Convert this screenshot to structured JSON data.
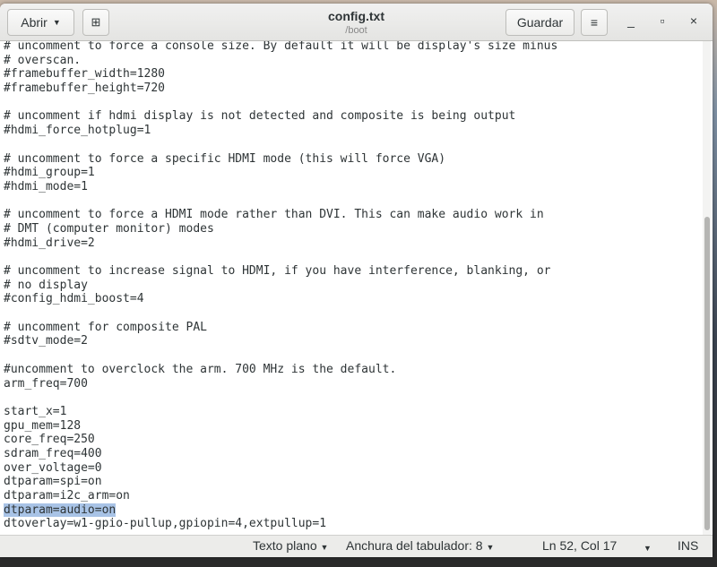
{
  "header": {
    "open_label": "Abrir",
    "title": "config.txt",
    "subtitle": "/boot",
    "save_label": "Guardar"
  },
  "editor": {
    "lines": [
      "# uncomment to force a console size. By default it will be display's size minus",
      "# overscan.",
      "#framebuffer_width=1280",
      "#framebuffer_height=720",
      "",
      "# uncomment if hdmi display is not detected and composite is being output",
      "#hdmi_force_hotplug=1",
      "",
      "# uncomment to force a specific HDMI mode (this will force VGA)",
      "#hdmi_group=1",
      "#hdmi_mode=1",
      "",
      "# uncomment to force a HDMI mode rather than DVI. This can make audio work in",
      "# DMT (computer monitor) modes",
      "#hdmi_drive=2",
      "",
      "# uncomment to increase signal to HDMI, if you have interference, blanking, or",
      "# no display",
      "#config_hdmi_boost=4",
      "",
      "# uncomment for composite PAL",
      "#sdtv_mode=2",
      "",
      "#uncomment to overclock the arm. 700 MHz is the default.",
      "arm_freq=700",
      "",
      "start_x=1",
      "gpu_mem=128",
      "core_freq=250",
      "sdram_freq=400",
      "over_voltage=0",
      "dtparam=spi=on",
      "dtparam=i2c_arm=on",
      "dtparam=audio=on",
      "dtoverlay=w1-gpio-pullup,gpiopin=4,extpullup=1"
    ],
    "selected_line": 33
  },
  "status": {
    "language": "Texto plano",
    "tab_width": "Anchura del tabulador: 8",
    "position": "Ln 52, Col 17",
    "mode": "INS"
  },
  "colors": {
    "selection": "#a8c3e6"
  }
}
